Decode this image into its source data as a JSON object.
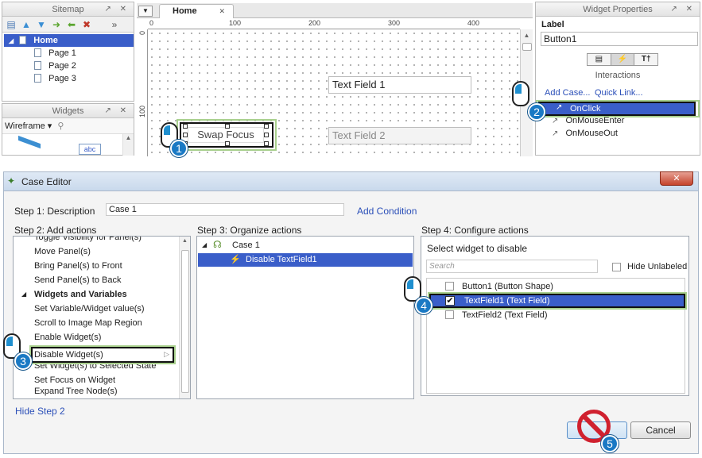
{
  "sitemap": {
    "title": "Sitemap",
    "controls": "↗ ✕",
    "home": "Home",
    "pages": [
      "Page 1",
      "Page 2",
      "Page 3"
    ]
  },
  "widgets_panel": {
    "title": "Widgets",
    "controls": "↗ ✕",
    "library": "Wireframe",
    "abc_label": "abc"
  },
  "canvas": {
    "tab_label": "Home",
    "tab_close": "✕",
    "ruler_h": [
      "0",
      "100",
      "200",
      "300",
      "400"
    ],
    "ruler_v": [
      "0",
      "100"
    ],
    "swap_button": "Swap Focus",
    "text_field_1": "Text Field 1",
    "text_field_2": "Text Field 2"
  },
  "widget_properties": {
    "title": "Widget Properties",
    "controls": "↗ ✕",
    "label_heading": "Label",
    "label_value": "Button1",
    "section": "Interactions",
    "add_case": "Add Case...",
    "quick_link": "Quick Link...",
    "events": [
      "OnClick",
      "OnMouseEnter",
      "OnMouseOut"
    ]
  },
  "case_editor": {
    "title": "Case Editor",
    "close": "✕",
    "step1_label": "Step 1: Description",
    "description": "Case 1",
    "add_condition": "Add Condition",
    "step2_label": "Step 2: Add actions",
    "step3_label": "Step 3: Organize actions",
    "step4_label": "Step 4: Configure actions",
    "actions_partial": "Toggle Visibility for Panel(s)",
    "actions": [
      "Move Panel(s)",
      "Bring Panel(s) to Front",
      "Send Panel(s) to Back",
      "Widgets and Variables",
      "Set Variable/Widget value(s)",
      "Scroll to Image Map Region",
      "Enable Widget(s)",
      "Disable Widget(s)",
      "Set Widget(s) to Selected State",
      "Set Focus on Widget",
      "Expand Tree Node(s)"
    ],
    "organize_case": "Case 1",
    "organize_action": "Disable TextField1",
    "configure_heading": "Select widget to disable",
    "search_placeholder": "Search",
    "hide_unlabeled": "Hide Unlabeled",
    "widgets": [
      {
        "label": "Button1 (Button Shape)",
        "checked": false
      },
      {
        "label": "TextField1 (Text Field)",
        "checked": true
      },
      {
        "label": "TextField2 (Text Field)",
        "checked": false
      }
    ],
    "hide_step": "Hide Step 2",
    "cancel": "Cancel"
  },
  "callouts": [
    "1",
    "2",
    "3",
    "4",
    "5"
  ],
  "colors": {
    "selection_blue": "#3a5ec9",
    "highlight_green": "#a8d08d",
    "badge_blue": "#1a79c4"
  }
}
